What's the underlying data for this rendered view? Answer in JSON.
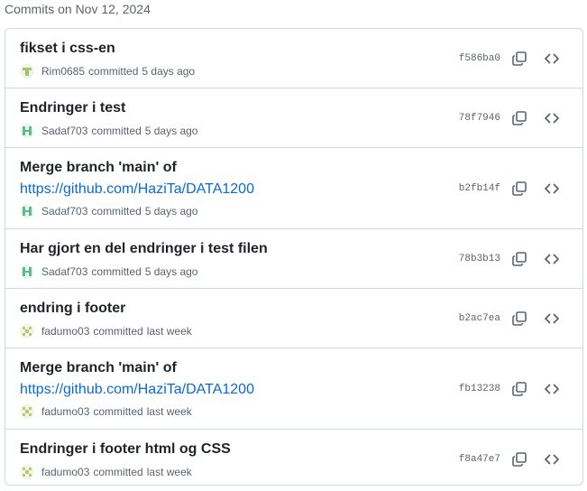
{
  "group": {
    "header": "Commits on Nov 12, 2024"
  },
  "commits": [
    {
      "title": "fikset i css-en",
      "author": "Rim0685",
      "action": "committed",
      "time": "5 days ago",
      "sha": "f586ba0",
      "avatar_color": "#a4c365"
    },
    {
      "title": "Endringer i test",
      "author": "Sadaf703",
      "action": "committed",
      "time": "5 days ago",
      "sha": "78f7946",
      "avatar_color": "#5fb98a"
    },
    {
      "title": "Merge branch 'main' of",
      "title_link": "https://github.com/HaziTa/DATA1200",
      "author": "Sadaf703",
      "action": "committed",
      "time": "5 days ago",
      "sha": "b2fb14f",
      "avatar_color": "#5fb98a"
    },
    {
      "title": "Har gjort en del endringer i test filen",
      "author": "Sadaf703",
      "action": "committed",
      "time": "5 days ago",
      "sha": "78b3b13",
      "avatar_color": "#5fb98a"
    },
    {
      "title": "endring i footer",
      "author": "fadumo03",
      "action": "committed",
      "time": "last week",
      "sha": "b2ac7ea",
      "avatar_color": "#b7c97a"
    },
    {
      "title": "Merge branch 'main' of",
      "title_link": "https://github.com/HaziTa/DATA1200",
      "author": "fadumo03",
      "action": "committed",
      "time": "last week",
      "sha": "fb13238",
      "avatar_color": "#b7c97a"
    },
    {
      "title": "Endringer i footer html og CSS",
      "author": "fadumo03",
      "action": "committed",
      "time": "last week",
      "sha": "f8a47e7",
      "avatar_color": "#b7c97a"
    }
  ],
  "icons": {
    "copy": "copy-icon",
    "browse": "code-icon"
  },
  "colors": {
    "link": "#0969da",
    "muted": "#59636e",
    "border": "#d1d9e0"
  }
}
